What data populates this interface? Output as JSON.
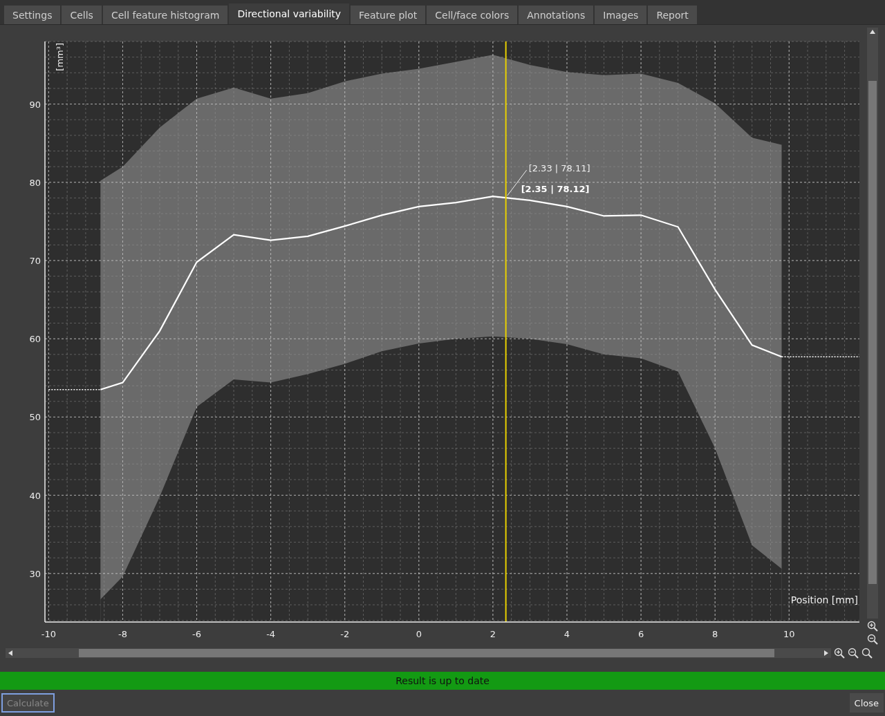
{
  "tabs": [
    {
      "label": "Settings",
      "selected": false
    },
    {
      "label": "Cells",
      "selected": false
    },
    {
      "label": "Cell feature histogram",
      "selected": false
    },
    {
      "label": "Directional variability",
      "selected": true
    },
    {
      "label": "Feature plot",
      "selected": false
    },
    {
      "label": "Cell/face colors",
      "selected": false
    },
    {
      "label": "Annotations",
      "selected": false
    },
    {
      "label": "Images",
      "selected": false
    },
    {
      "label": "Report",
      "selected": false
    }
  ],
  "chart": {
    "chart_data": {
      "type": "area",
      "xlabel": "Position [mm]",
      "ylabel": "[mm³]",
      "x": [
        -10,
        -8.6,
        -8,
        -7,
        -6,
        -5,
        -4,
        -3,
        -2,
        -1,
        0,
        1,
        2,
        3,
        4,
        5,
        6,
        7,
        8,
        9,
        9.8,
        11.9
      ],
      "series": [
        {
          "color": "#6a6a6a",
          "values": [
            null,
            80.2,
            82,
            87,
            90.7,
            92.1,
            90.7,
            91.4,
            92.9,
            93.9,
            94.5,
            95.4,
            96.3,
            95,
            94.1,
            93.7,
            93.9,
            92.7,
            90.1,
            85.7,
            84.8,
            null
          ]
        },
        {
          "type": "line",
          "color": "#ffffff",
          "values": [
            null,
            53.5,
            54.4,
            61,
            69.8,
            73.3,
            72.6,
            73.1,
            74.4,
            75.8,
            76.9,
            77.4,
            78.2,
            77.7,
            76.9,
            75.7,
            75.8,
            74.3,
            66.3,
            59.2,
            57.7,
            null
          ]
        },
        {
          "color": "#2e2e2e",
          "values": [
            null,
            26.7,
            29.6,
            39.8,
            51.3,
            54.8,
            54.4,
            55.5,
            56.8,
            58.4,
            59.4,
            60,
            60.3,
            60,
            59.3,
            58,
            57.5,
            55.8,
            46,
            33.6,
            30.6,
            null
          ]
        },
        {
          "type": "line",
          "line_style": "dotted",
          "color": "#ffffff",
          "values": [
            53.5,
            53.5,
            null,
            null,
            null,
            null,
            null,
            null,
            null,
            null,
            null,
            null,
            null,
            null,
            null,
            null,
            null,
            null,
            null,
            null,
            57.7,
            57.7
          ]
        }
      ],
      "xlim": [
        -10.1,
        11.9
      ],
      "ylim": [
        23.8,
        98
      ],
      "xticks": [
        -10,
        -8,
        -6,
        -4,
        -2,
        0,
        2,
        4,
        6,
        8,
        10
      ],
      "yticks": [
        30,
        40,
        50,
        60,
        70,
        80,
        90
      ],
      "grid": true,
      "ref_lines": [
        {
          "axis": "x",
          "value": 2.35
        }
      ],
      "annotations": [
        "[2.33 | 78.11]",
        "[2.35 | 78.12]"
      ]
    }
  },
  "status": {
    "text": "Result is up to date",
    "color": "#139a13"
  },
  "calculate_button": {
    "label": "Calculate",
    "disabled": true
  },
  "close_button": {
    "label": "Close"
  }
}
